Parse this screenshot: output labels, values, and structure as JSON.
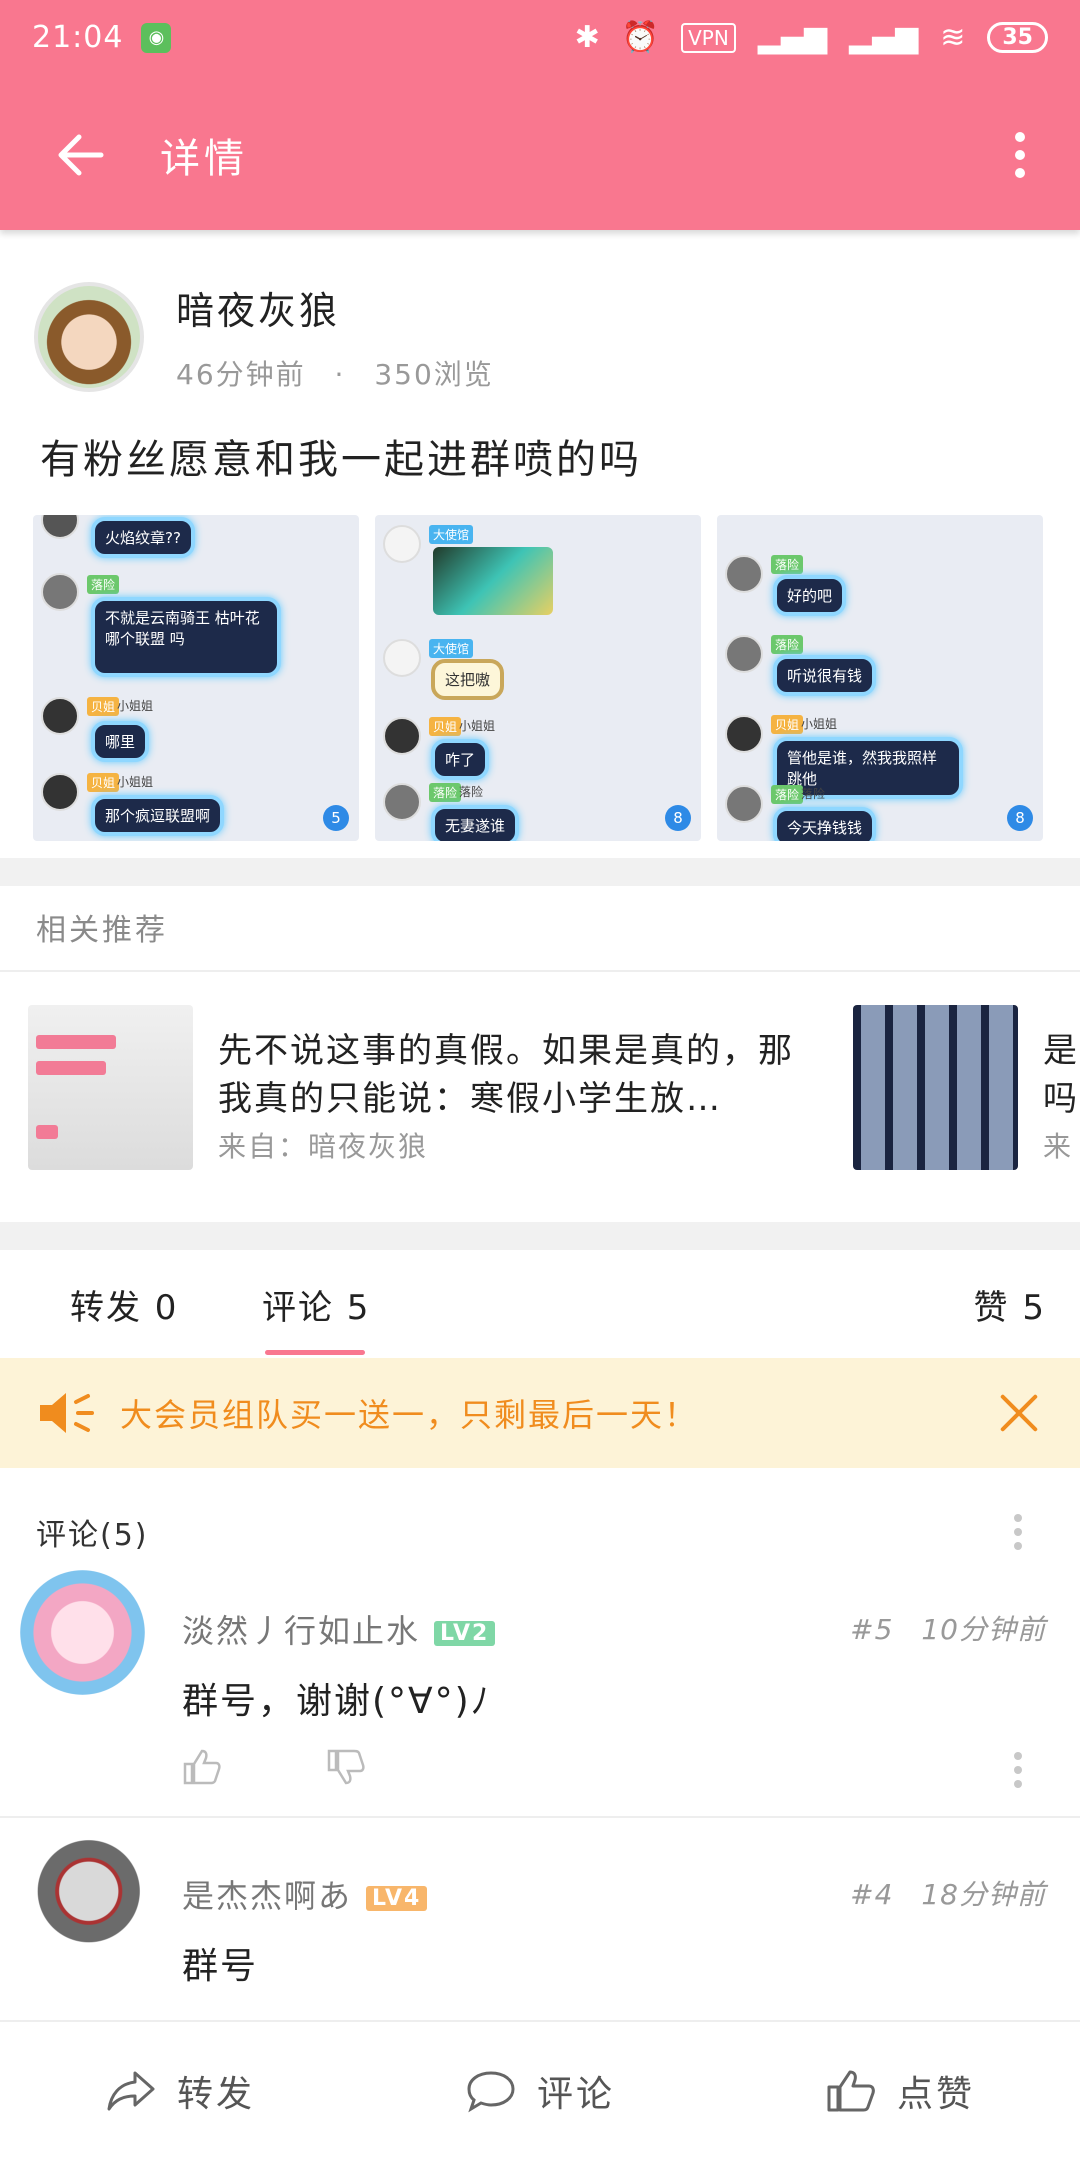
{
  "status": {
    "time": "21:04",
    "app_icon": "android-notification-icon",
    "vpn": "VPN",
    "battery": "35"
  },
  "toolbar": {
    "title": "详情"
  },
  "post": {
    "author_name": "暗夜灰狼",
    "time_ago": "46分钟前",
    "separator": "·",
    "views": "350浏览",
    "text": "有粉丝愿意和我一起进群喷的吗",
    "images": [
      {
        "count": "5",
        "bubbles": [
          "火焰纹章??",
          "不就是云南骑王 枯叶花哪个联盟 吗",
          "哪里",
          "那个疯逗联盟啊"
        ],
        "tags": [
          "落险",
          "贝姐",
          "贝姐"
        ],
        "names": [
          "小姐姐",
          "小姐姐"
        ]
      },
      {
        "count": "8",
        "bubbles": [
          "这把嗷",
          "咋了",
          "无妻遂谁"
        ],
        "tags": [
          "大使馆",
          "大使馆",
          "贝姐",
          "落险"
        ],
        "names": [
          "小姐姐",
          "落险"
        ]
      },
      {
        "count": "8",
        "bubbles": [
          "好的吧",
          "听说很有钱",
          "管他是谁，然我我照样跳他",
          "今天挣钱钱"
        ],
        "tags": [
          "落险",
          "落险",
          "贝姐",
          "落险"
        ],
        "names": [
          "小姐姐",
          "落险"
        ]
      }
    ]
  },
  "related": {
    "title": "相关推荐",
    "items": [
      {
        "text": "先不说这事的真假。如果是真的，那我真的只能说：寒假小学生放…",
        "source": "来自：暗夜灰狼"
      },
      {
        "text": "是吗",
        "source": "来"
      }
    ]
  },
  "tabs": {
    "repost": "转发 0",
    "comment": "评论 5",
    "like": "赞 5"
  },
  "banner": {
    "text": "大会员组队买一送一，只剩最后一天！"
  },
  "comments": {
    "header": "评论(5)",
    "items": [
      {
        "name": "淡然丿行如止水",
        "level": "LV2",
        "level_color": "#7fd7a6",
        "floor": "#5",
        "time": "10分钟前",
        "text": "群号，谢谢(°∀°)ﾉ"
      },
      {
        "name": "是杰杰啊あ",
        "level": "LV4",
        "level_color": "#f8b66b",
        "floor": "#4",
        "time": "18分钟前",
        "text": "群号"
      }
    ]
  },
  "bottombar": {
    "repost": "转发",
    "comment": "评论",
    "like": "点赞"
  },
  "colors": {
    "accent": "#f9778f",
    "banner_bg": "#fdf3d7",
    "banner_text": "#f08c1e"
  }
}
